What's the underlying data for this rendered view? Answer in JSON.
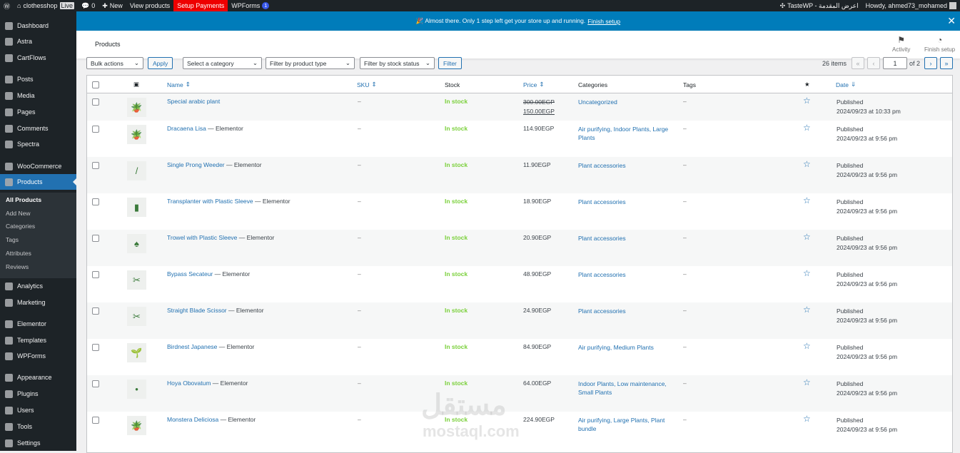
{
  "adminbar": {
    "site": "clothesshop",
    "live": "Live",
    "comments": "0",
    "new": "New",
    "view": "View products",
    "setup": "Setup Payments",
    "wpforms": "WPForms",
    "wpforms_count": "1",
    "tastewp": "TasteWP - اعرض المقدمة",
    "howdy": "Howdy, ahmed73_mohamed"
  },
  "sidebar": {
    "items": [
      "Dashboard",
      "Astra",
      "CartFlows",
      "Posts",
      "Media",
      "Pages",
      "Comments",
      "Spectra",
      "WooCommerce",
      "Products",
      "Analytics",
      "Marketing",
      "Elementor",
      "Templates",
      "WPForms",
      "Appearance",
      "Plugins",
      "Users",
      "Tools",
      "Settings"
    ],
    "sub": [
      "All Products",
      "Add New",
      "Categories",
      "Tags",
      "Attributes",
      "Reviews"
    ]
  },
  "notice": {
    "text": "🎉 Almost there. Only 1 step left get your store up and running.",
    "link": "Finish setup"
  },
  "header": {
    "title": "Products",
    "activity": "Activity",
    "finish": "Finish setup"
  },
  "toolbar": {
    "bulk": "Bulk actions",
    "apply": "Apply",
    "category": "Select a category",
    "type": "Filter by product type",
    "stock": "Filter by stock status",
    "filter": "Filter",
    "items": "26 items",
    "page": "1",
    "of": "of 2"
  },
  "columns": {
    "name": "Name",
    "sku": "SKU",
    "stock": "Stock",
    "price": "Price",
    "categories": "Categories",
    "tags": "Tags",
    "date": "Date"
  },
  "rows": [
    {
      "name": "Special arabic plant",
      "suffix": "",
      "sku": "–",
      "stock": "In stock",
      "old_price": "300.00EGP",
      "price": "150.00EGP",
      "cats": "Uncategorized",
      "tags": "–",
      "status": "Published",
      "date": "2024/09/23 at 10:33 pm",
      "icon": "🪴"
    },
    {
      "name": "Dracaena Lisa",
      "suffix": " — Elementor",
      "sku": "–",
      "stock": "In stock",
      "price": "114.90EGP",
      "cats": "Air purifying, Indoor Plants, Large Plants",
      "tags": "–",
      "status": "Published",
      "date": "2024/09/23 at 9:56 pm",
      "icon": "🪴"
    },
    {
      "name": "Single Prong Weeder",
      "suffix": " — Elementor",
      "sku": "–",
      "stock": "In stock",
      "price": "11.90EGP",
      "cats": "Plant accessories",
      "tags": "–",
      "status": "Published",
      "date": "2024/09/23 at 9:56 pm",
      "icon": "/"
    },
    {
      "name": "Transplanter with Plastic Sleeve",
      "suffix": " — Elementor",
      "sku": "–",
      "stock": "In stock",
      "price": "18.90EGP",
      "cats": "Plant accessories",
      "tags": "–",
      "status": "Published",
      "date": "2024/09/23 at 9:56 pm",
      "icon": "▮"
    },
    {
      "name": "Trowel with Plastic Sleeve",
      "suffix": " — Elementor",
      "sku": "–",
      "stock": "In stock",
      "price": "20.90EGP",
      "cats": "Plant accessories",
      "tags": "–",
      "status": "Published",
      "date": "2024/09/23 at 9:56 pm",
      "icon": "♠"
    },
    {
      "name": "Bypass Secateur",
      "suffix": " — Elementor",
      "sku": "–",
      "stock": "In stock",
      "price": "48.90EGP",
      "cats": "Plant accessories",
      "tags": "–",
      "status": "Published",
      "date": "2024/09/23 at 9:56 pm",
      "icon": "✂"
    },
    {
      "name": "Straight Blade Scissor",
      "suffix": " — Elementor",
      "sku": "–",
      "stock": "In stock",
      "price": "24.90EGP",
      "cats": "Plant accessories",
      "tags": "–",
      "status": "Published",
      "date": "2024/09/23 at 9:56 pm",
      "icon": "✂"
    },
    {
      "name": "Birdnest Japanese",
      "suffix": " — Elementor",
      "sku": "–",
      "stock": "In stock",
      "price": "84.90EGP",
      "cats": "Air purifying, Medium Plants",
      "tags": "–",
      "status": "Published",
      "date": "2024/09/23 at 9:56 pm",
      "icon": "🌱"
    },
    {
      "name": "Hoya Obovatum",
      "suffix": " — Elementor",
      "sku": "–",
      "stock": "In stock",
      "price": "64.00EGP",
      "cats": "Indoor Plants, Low maintenance, Small Plants",
      "tags": "–",
      "status": "Published",
      "date": "2024/09/23 at 9:56 pm",
      "icon": "•"
    },
    {
      "name": "Monstera Deliciosa",
      "suffix": " — Elementor",
      "sku": "–",
      "stock": "In stock",
      "price": "224.90EGP",
      "cats": "Air purifying, Large Plants, Plant bundle",
      "tags": "–",
      "status": "Published",
      "date": "2024/09/23 at 9:56 pm",
      "icon": "🪴"
    }
  ],
  "watermark": {
    "ar": "مستقل",
    "en": "mostaql.com"
  }
}
